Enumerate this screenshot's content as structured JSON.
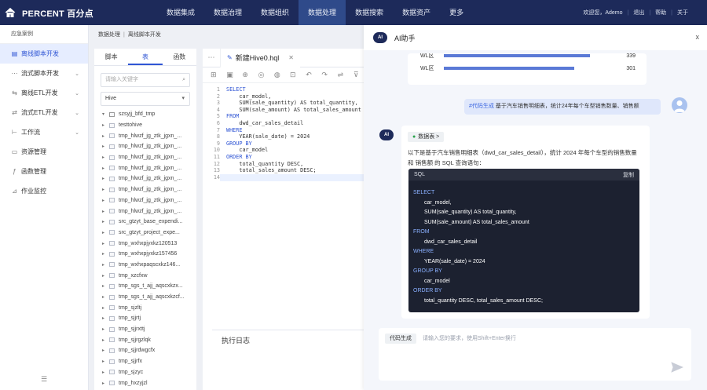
{
  "header": {
    "logo": "PERCENT 百分点",
    "nav": [
      "数据集成",
      "数据治理",
      "数据组织",
      "数据处理",
      "数据搜索",
      "数据资产",
      "更多"
    ],
    "active_nav": 3,
    "user": {
      "welcome": "欢迎您，Ademo",
      "logout": "退出",
      "help": "帮助",
      "about": "关于"
    }
  },
  "sidebar": {
    "header": "应急案例",
    "items": [
      {
        "label": "离线脚本开发",
        "icon": "script-icon",
        "active": true
      },
      {
        "label": "流式脚本开发",
        "icon": "stream-icon",
        "chevron": true
      },
      {
        "label": "离线ETL开发",
        "icon": "etl-icon",
        "chevron": true
      },
      {
        "label": "流式ETL开发",
        "icon": "stream-etl-icon",
        "chevron": true
      },
      {
        "label": "工作流",
        "icon": "workflow-icon",
        "chevron": true
      },
      {
        "label": "资源管理",
        "icon": "folder-icon"
      },
      {
        "label": "函数管理",
        "icon": "function-icon"
      },
      {
        "label": "作业监控",
        "icon": "monitor-icon"
      }
    ],
    "footer_icon": "collapse-icon"
  },
  "breadcrumb": {
    "parent": "数据处理",
    "current": "离线脚本开发"
  },
  "treepanel": {
    "tabs": [
      "脚本",
      "表",
      "函数"
    ],
    "active_tab": 1,
    "search_placeholder": "请输入关键字",
    "db_select": "Hive",
    "root": "szsyjj_bfd_tmp",
    "nodes": [
      "testtohive",
      "tmp_hlwzf_jg_ztk_jgxn_...",
      "tmp_hlwzf_jg_ztk_jgxn_...",
      "tmp_hlwzf_jg_ztk_jgxn_...",
      "tmp_hlwzf_jg_ztk_jgxn_...",
      "tmp_hlwzf_jg_ztk_jgxn_...",
      "tmp_hlwzf_jg_ztk_jgxn_...",
      "tmp_hlwzf_jg_ztk_jgxn_...",
      "tmp_hlwzf_jg_ztk_jgxn_...",
      "src_gtzyt_base_expendi...",
      "src_gtzyt_project_expe...",
      "tmp_wxhxpjyxkz120513",
      "tmp_wxhxpjyxkz157456",
      "tmp_wxhxpaqscxkz146...",
      "tmp_xzcfxw",
      "tmp_sgs_t_ajj_aqscxkzx...",
      "tmp_sgs_t_ajj_aqscxkzcf...",
      "tmp_sjzltj",
      "tmp_sjjrtj",
      "tmp_sjjrxttj",
      "tmp_sjjrgzlqk",
      "tmp_sjjrdwgcfx",
      "tmp_sjjrfx",
      "tmp_sjzyc",
      "tmp_hxzyjzl"
    ]
  },
  "editor": {
    "tab_title": "新建Hive0.hql",
    "line_numbers": [
      "1",
      "2",
      "3",
      "4",
      "5",
      "6",
      "7",
      "8",
      "9",
      "10",
      "11",
      "12",
      "13",
      "14"
    ],
    "lines": [
      "SELECT",
      "    car_model,",
      "    SUM(sale_quantity) AS total_quantity,",
      "    SUM(sale_amount) AS total_sales_amount",
      "FROM",
      "    dwd_car_sales_detail",
      "WHERE",
      "    YEAR(sale_date) = 2024",
      "GROUP BY",
      "    car_model",
      "ORDER BY",
      "    total_quantity DESC,",
      "    total_sales_amount DESC;",
      ""
    ]
  },
  "log": {
    "title": "执行日志"
  },
  "ai": {
    "badge": "AI",
    "title": "AI助手",
    "close": "x",
    "stats": [
      {
        "label": "WL区",
        "value": 339,
        "fill": 0.93
      },
      {
        "label": "WL区",
        "value": 301,
        "fill": 0.83
      }
    ],
    "question_tag": "#代码生成",
    "question": " 基于汽车销售明细表，统计24年每个车型销售数量、销售额",
    "datasource": "数据表 >",
    "answer_text": "以下是基于汽车销售明细表（dwd_car_sales_detail），统计 2024 年每个车型的销售数量 和 销售额 的 SQL 查询语句：",
    "sql_label": "SQL",
    "copy_label": "复制",
    "sql": [
      {
        "t": "SELECT",
        "k": true,
        "i": 0
      },
      {
        "t": "car_model,",
        "k": false,
        "i": 1
      },
      {
        "t": "SUM(sale_quantity) AS total_quantity,",
        "k": false,
        "i": 1
      },
      {
        "t": "SUM(sale_amount) AS total_sales_amount",
        "k": false,
        "i": 1
      },
      {
        "t": "FROM",
        "k": true,
        "i": 0
      },
      {
        "t": "dwd_car_sales_detail",
        "k": false,
        "i": 1
      },
      {
        "t": "WHERE",
        "k": true,
        "i": 0
      },
      {
        "t": "YEAR(sale_date) = 2024",
        "k": false,
        "i": 1
      },
      {
        "t": "GROUP BY",
        "k": true,
        "i": 0
      },
      {
        "t": "car_model",
        "k": false,
        "i": 1
      },
      {
        "t": "ORDER BY",
        "k": true,
        "i": 0
      },
      {
        "t": "total_quantity DESC, total_sales_amount DESC;",
        "k": false,
        "i": 1
      }
    ],
    "input_tag": "代码生成",
    "input_placeholder": "请输入您的要求，使用Shift+Enter换行"
  }
}
